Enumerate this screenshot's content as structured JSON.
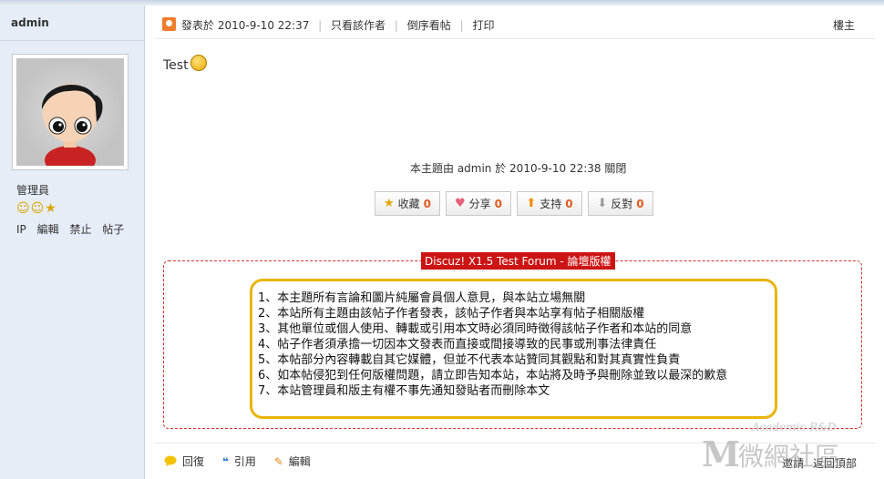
{
  "sidebar": {
    "username": "admin",
    "role": "管理員",
    "actions": [
      "IP",
      "編輯",
      "禁止",
      "帖子"
    ]
  },
  "post": {
    "meta": {
      "posted_label": "發表於",
      "datetime": "2010-9-10 22:37",
      "only_author": "只看該作者",
      "reverse_order": "倒序看帖",
      "print": "打印"
    },
    "floor": "樓主",
    "text": "Test",
    "closed_note": "本主題由 admin 於 2010-9-10 22:38 關閉"
  },
  "buttons": {
    "favorite": {
      "label": "收藏",
      "count": "0"
    },
    "share": {
      "label": "分享",
      "count": "0"
    },
    "support": {
      "label": "支持",
      "count": "0"
    },
    "oppose": {
      "label": "反對",
      "count": "0"
    }
  },
  "copyright": {
    "title": "Discuz! X1.5 Test Forum - 論壇版權",
    "items": [
      "1、本主題所有言論和圖片純屬會員個人意見，與本站立場無關",
      "2、本站所有主題由該帖子作者發表，該帖子作者與本站享有帖子相關版權",
      "3、其他單位或個人使用、轉載或引用本文時必須同時徵得該帖子作者和本站的同意",
      "4、帖子作者須承擔一切因本文發表而直接或間接導致的民事或刑事法律責任",
      "5、本帖部分內容轉載自其它媒體，但並不代表本站贊同其觀點和對其真實性負責",
      "6、如本帖侵犯到任何版權問題，請立即告知本站，本站將及時予與刪除並致以最深的歉意",
      "7、本站管理員和版主有權不事先通知發貼者而刪除本文"
    ]
  },
  "footer": {
    "reply": "回復",
    "quote": "引用",
    "edit": "編輯",
    "report": "邀請",
    "back_top": "返回頂部"
  },
  "watermark": {
    "text_en": "Academic R&D",
    "text_zh": "微網社區"
  },
  "colors": {
    "sidebar_bg": "#e6edf7",
    "accent_red": "#cc1414",
    "counter_orange": "#e05a20",
    "notice_border": "#e9b40b"
  }
}
